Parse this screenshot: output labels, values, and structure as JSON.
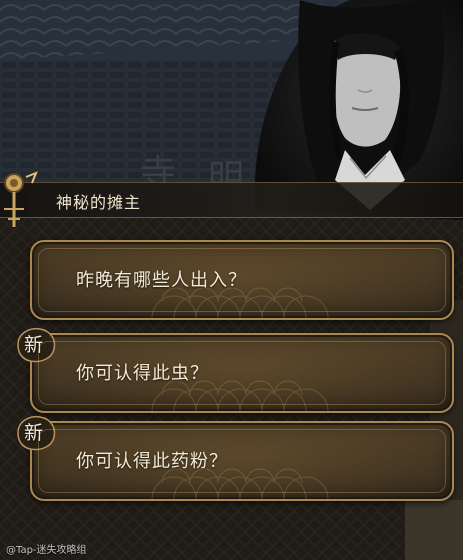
{
  "scene": {
    "sign_chars": [
      "寺",
      "明"
    ]
  },
  "dialogue": {
    "speaker_name": "神秘的摊主"
  },
  "options": [
    {
      "label": "昨晚有哪些人出入？",
      "is_new": false
    },
    {
      "label": "你可认得此虫？",
      "is_new": true,
      "badge": "新"
    },
    {
      "label": "你可认得此药粉？",
      "is_new": true,
      "badge": "新"
    }
  ],
  "watermark": "@Tap-迷失攻略组",
  "colors": {
    "panel_border": "#a8884f",
    "panel_fill": "#3b2f1f",
    "text": "#f3ead6",
    "name_bar": "#221e18"
  }
}
